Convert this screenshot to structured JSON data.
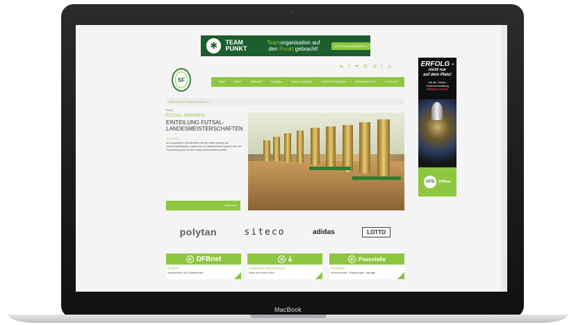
{
  "device": {
    "brand": "MacBook"
  },
  "banner_ad": {
    "brand_line1": "TEAM",
    "brand_line2": "PUNKT",
    "text_hl": "Team",
    "text_1": "organisation auf",
    "text_2": "den",
    "text_hl2": "Punkt",
    "text_3": "gebracht!",
    "cta": "JETZT AUSPROBIEREN >"
  },
  "header": {
    "logo_text": "SF",
    "social_icons": [
      "mail-icon",
      "facebook-icon",
      "twitter-icon",
      "rss-icon",
      "print-icon",
      "search-icon"
    ],
    "nav": [
      "Home",
      "News",
      "Verband",
      "Fussball",
      "Qualifizierung",
      "Talentförderung",
      "Vereinsservice",
      "Sozialeg"
    ]
  },
  "breadcrumb": "Sächsischer Fußball-Verband e.V.",
  "article": {
    "kicker_small": "Futsal",
    "kicker": "FUTSAL JUNIOREN",
    "headline": "EINTEILUNG FUTSAL-LANDESMEISTERSCHAFTEN",
    "date": "16.12.2016",
    "teaser": "Am vergangenen Wochenende war der letzte Spieltag der Juniorenspielklassen. Anhand der Ist-Tabellenstände ergeben sich die Vorrundengruppen für die Futsal-Landesmeisterschaften.",
    "more": "Weiterlesen"
  },
  "sponsors": [
    "polytan",
    "siteco",
    "adidas",
    "LOTTO"
  ],
  "tiles": [
    {
      "head": "DFBnet",
      "icon": "dfb-icon",
      "title": "DFBnet",
      "sub": "Spielbetrieb und Spielbetrieb"
    },
    {
      "head": "",
      "icon": "download-icon",
      "title": "Downloads und Formulare",
      "sub": "Alles mit einem Klick"
    },
    {
      "head": "Passstelle",
      "icon": "pass-icon",
      "title": "Passstelle",
      "sub": "Informationen, Regelungen, Anträge"
    }
  ],
  "sky_ad": {
    "title": "ERFOLG -",
    "sub1": "nicht nur",
    "sub2": "auf dem Platz!",
    "small1": "Mit der Online-",
    "small2": "Vereinsverwaltung",
    "red": "DFBnet Verein",
    "foot": "DFBnet"
  },
  "colors": {
    "accent": "#8dc63f",
    "dark_green": "#1c5e2d"
  }
}
